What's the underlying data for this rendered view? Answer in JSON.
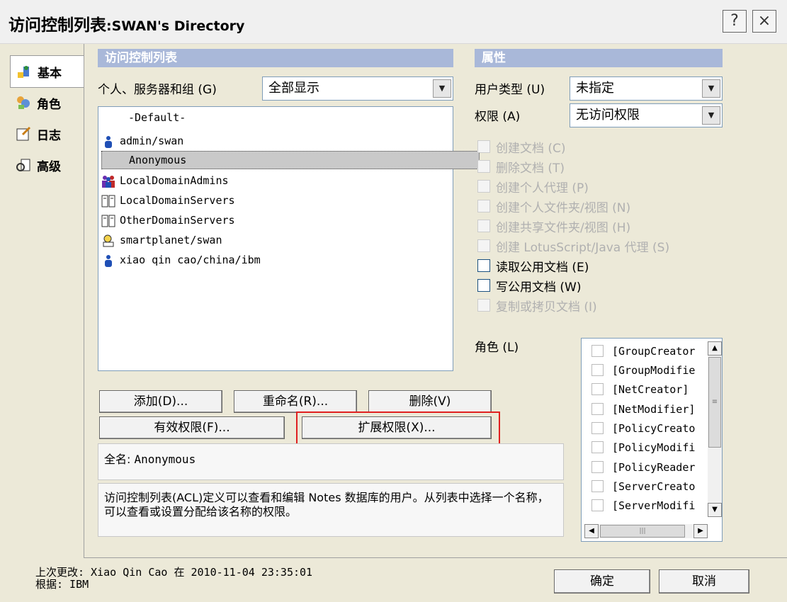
{
  "window": {
    "title_main": "访问控制列表",
    "title_sub": ":SWAN's Directory",
    "help_label": "?",
    "close_label": "×"
  },
  "sidebar": {
    "items": [
      {
        "label": "基本",
        "icon": "user-icon"
      },
      {
        "label": "角色",
        "icon": "roles-icon"
      },
      {
        "label": "日志",
        "icon": "log-icon"
      },
      {
        "label": "高级",
        "icon": "advanced-icon"
      }
    ]
  },
  "acl": {
    "header": "访问控制列表",
    "filter_label": "个人、服务器和组 (G)",
    "filter_value": "全部显示",
    "entries": [
      {
        "name": "-Default-",
        "icon": "none"
      },
      {
        "name": "admin/swan",
        "icon": "person-icon"
      },
      {
        "name": "Anonymous",
        "icon": "none"
      },
      {
        "name": "LocalDomainAdmins",
        "icon": "group-icon"
      },
      {
        "name": "LocalDomainServers",
        "icon": "server-group-icon"
      },
      {
        "name": "OtherDomainServers",
        "icon": "server-group-icon"
      },
      {
        "name": "smartplanet/swan",
        "icon": "server-icon"
      },
      {
        "name": "xiao qin cao/china/ibm",
        "icon": "person-icon"
      }
    ],
    "buttons": {
      "add": "添加(D)...",
      "rename": "重命名(R)...",
      "delete": "删除(V)",
      "effective": "有效权限(F)...",
      "extended": "扩展权限(X)..."
    },
    "fullname_label": "全名:",
    "fullname_value": "Anonymous",
    "description": "访问控制列表(ACL)定义可以查看和编辑 Notes 数据库的用户。从列表中选择一个名称，可以查看或设置分配给该名称的权限。"
  },
  "attributes": {
    "header": "属性",
    "user_type_label": "用户类型 (U)",
    "user_type_value": "未指定",
    "access_label": "权限 (A)",
    "access_value": "无访问权限",
    "permissions": [
      {
        "label": "创建文档 (C)",
        "enabled": false
      },
      {
        "label": "删除文档 (T)",
        "enabled": false
      },
      {
        "label": "创建个人代理 (P)",
        "enabled": false
      },
      {
        "label": "创建个人文件夹/视图 (N)",
        "enabled": false
      },
      {
        "label": "创建共享文件夹/视图 (H)",
        "enabled": false
      },
      {
        "label": "创建 LotusScript/Java 代理 (S)",
        "enabled": false
      },
      {
        "label": "读取公用文档 (E)",
        "enabled": true
      },
      {
        "label": "写公用文档 (W)",
        "enabled": true
      },
      {
        "label": "复制或拷贝文档 (I)",
        "enabled": false
      }
    ],
    "roles_label": "角色 (L)",
    "roles": [
      "[GroupCreator",
      "[GroupModifie",
      "[NetCreator]",
      "[NetModifier]",
      "[PolicyCreato",
      "[PolicyModifi",
      "[PolicyReader",
      "[ServerCreato",
      "[ServerModifi"
    ]
  },
  "footer": {
    "last_modified": "上次更改: Xiao Qin Cao 在 2010-11-04 23:35:01",
    "based_on": "根据: IBM",
    "ok": "确定",
    "cancel": "取消"
  },
  "colors": {
    "section_header": "#a9b8d9",
    "highlight_border": "#e02020"
  }
}
